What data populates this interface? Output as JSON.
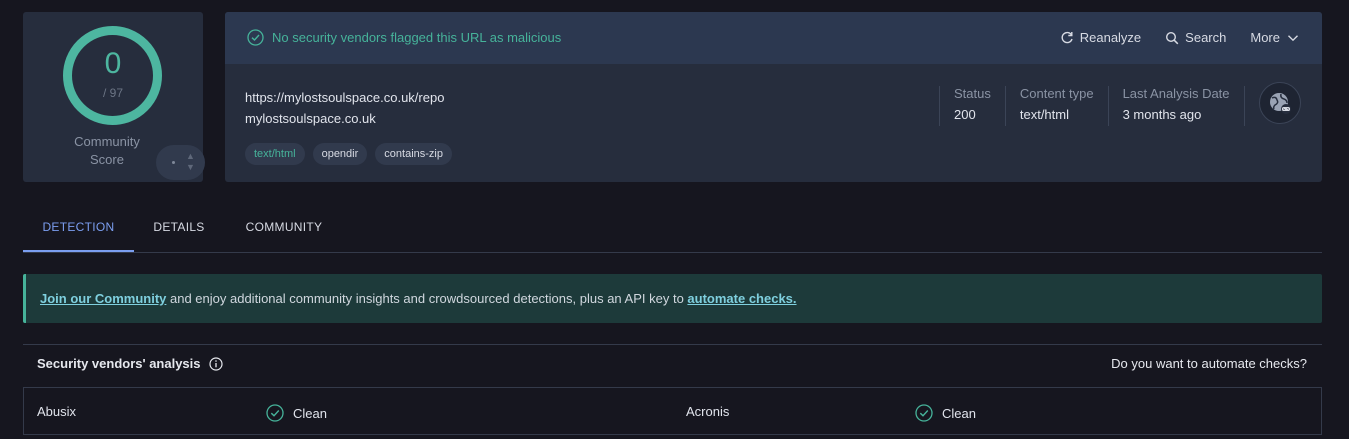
{
  "score": {
    "detections": "0",
    "total": "/ 97",
    "community_label": "Community\nScore",
    "ring_color": "#4db6a0"
  },
  "banner": {
    "message": "No security vendors flagged this URL as malicious",
    "actions": {
      "reanalyze": "Reanalyze",
      "search": "Search",
      "more": "More"
    }
  },
  "target": {
    "url": "https://mylostsoulspace.co.uk/repo",
    "domain": "mylostsoulspace.co.uk",
    "tags": [
      "text/html",
      "opendir",
      "contains-zip"
    ]
  },
  "meta": {
    "status_label": "Status",
    "status_value": "200",
    "content_label": "Content type",
    "content_value": "text/html",
    "date_label": "Last Analysis Date",
    "date_value": "3 months ago"
  },
  "tabs": [
    "DETECTION",
    "DETAILS",
    "COMMUNITY"
  ],
  "join": {
    "link1": "Join our Community",
    "middle": " and enjoy additional community insights and crowdsourced detections, plus an API key to ",
    "link2": "automate checks."
  },
  "vendors": {
    "title": "Security vendors' analysis",
    "automate": "Do you want to automate checks?",
    "rows": [
      {
        "left_name": "Abusix",
        "left_result": "Clean",
        "right_name": "Acronis",
        "right_result": "Clean"
      }
    ]
  },
  "colors": {
    "accent": "#7b9ef0",
    "clean": "#46b39a",
    "background": "#16161f",
    "card": "#262d3d"
  }
}
